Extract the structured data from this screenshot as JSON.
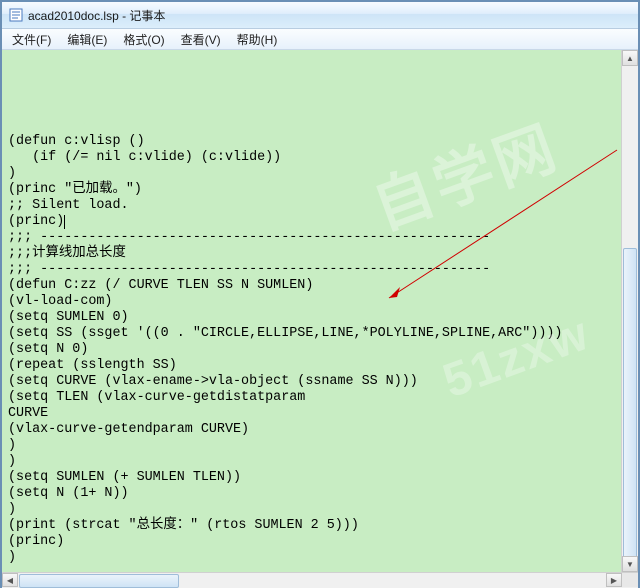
{
  "window": {
    "title": "acad2010doc.lsp - 记事本"
  },
  "menubar": {
    "file": "文件(F)",
    "edit": "编辑(E)",
    "format": "格式(O)",
    "view": "查看(V)",
    "help": "帮助(H)"
  },
  "watermark": {
    "line1": "自学网",
    "line2": "51zxw"
  },
  "editor": {
    "lines": [
      "",
      "(defun c:vlisp ()",
      "   (if (/= nil c:vlide) (c:vlide))",
      ")",
      "",
      "(princ \"已加载。\")",
      "",
      ";; Silent load.",
      "(princ)",
      "",
      "",
      ";;; --------------------------------------------------------",
      ";;;计算线加总长度",
      ";;; --------------------------------------------------------",
      "(defun C:zz (/ CURVE TLEN SS N SUMLEN)",
      "(vl-load-com)",
      "(setq SUMLEN 0)",
      "(setq SS (ssget '((0 . \"CIRCLE,ELLIPSE,LINE,*POLYLINE,SPLINE,ARC\"))))",
      "(setq N 0)",
      "(repeat (sslength SS)",
      "(setq CURVE (vlax-ename->vla-object (ssname SS N)))",
      "(setq TLEN (vlax-curve-getdistatparam",
      "CURVE",
      "(vlax-curve-getendparam CURVE)",
      ")",
      ")",
      "(setq SUMLEN (+ SUMLEN TLEN))",
      "(setq N (1+ N))",
      ")",
      "(print (strcat \"总长度：\" (rtos SUMLEN 2 5)))",
      "(princ)",
      ")"
    ]
  }
}
